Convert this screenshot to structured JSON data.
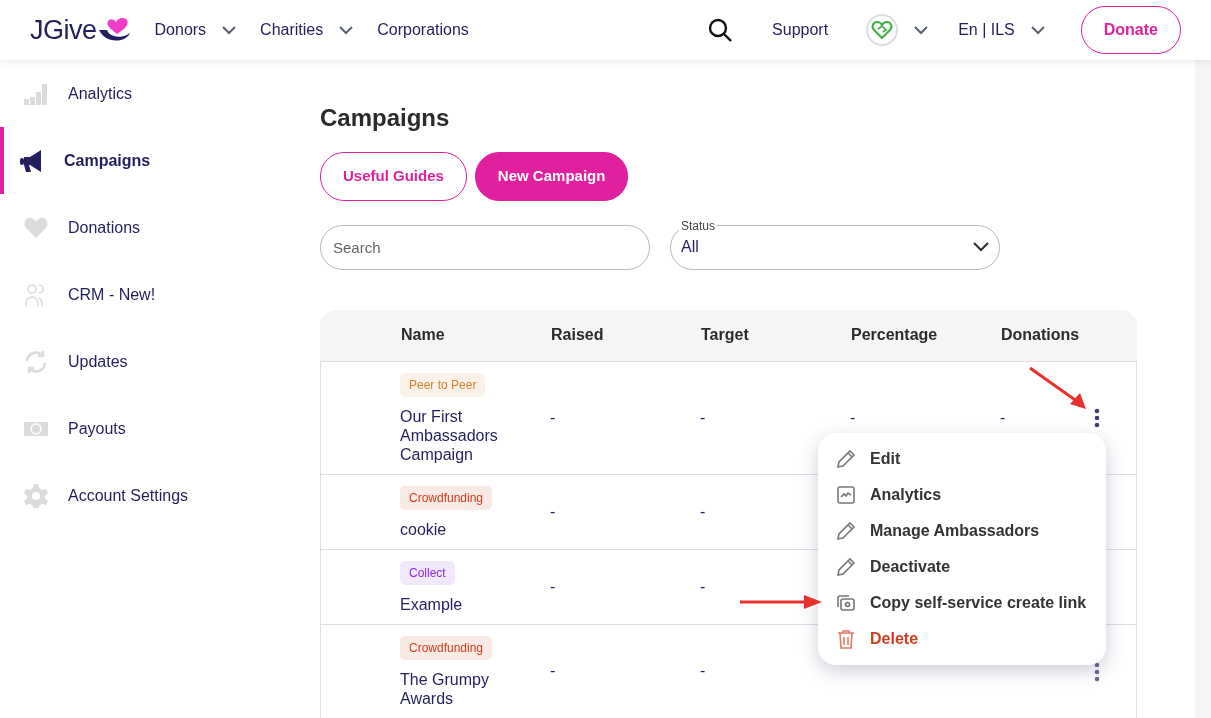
{
  "navbar": {
    "logo": "JGive",
    "items": [
      {
        "label": "Donors",
        "dropdown": true
      },
      {
        "label": "Charities",
        "dropdown": true
      },
      {
        "label": "Corporations",
        "dropdown": false
      }
    ],
    "support": "Support",
    "language": "En | ILS",
    "donate": "Donate"
  },
  "sidebar": {
    "items": [
      {
        "label": "Analytics",
        "selected": false
      },
      {
        "label": "Campaigns",
        "selected": true
      },
      {
        "label": "Donations",
        "selected": false
      },
      {
        "label": "CRM - New!",
        "selected": false
      },
      {
        "label": "Updates",
        "selected": false
      },
      {
        "label": "Payouts",
        "selected": false
      },
      {
        "label": "Account Settings",
        "selected": false
      }
    ]
  },
  "page_title": "Campaigns",
  "buttons": [
    {
      "label": "Useful Guides",
      "kind": "outline"
    },
    {
      "label": "New Campaign",
      "kind": "solid"
    }
  ],
  "search": {
    "placeholder": "Search"
  },
  "status": {
    "label": "Status",
    "value": "All"
  },
  "table": {
    "columns": [
      "Name",
      "Raised",
      "Target",
      "Percentage",
      "Donations"
    ],
    "rows": [
      {
        "tag": {
          "text": "Peer to Peer",
          "color": "#d4822e"
        },
        "name": "Our First Ambassadors Campaign",
        "raised": "-",
        "target": "-",
        "percentage": "-",
        "donations": "-",
        "menu_open": true
      },
      {
        "tag": {
          "text": "Crowdfunding",
          "color": "#d23c1e"
        },
        "name": "cookie",
        "raised": "-",
        "target": "-",
        "menu_open": false
      },
      {
        "tag": {
          "text": "Collect",
          "color": "#8a2be2"
        },
        "name": "Example",
        "raised": "-",
        "target": "-",
        "menu_open": false
      },
      {
        "tag": {
          "text": "Crowdfunding",
          "color": "#d23c1e"
        },
        "name": "The Grumpy Awards",
        "raised": "-",
        "target": "-",
        "menu_open": false
      }
    ]
  },
  "row_menu": {
    "items": [
      {
        "label": "Edit",
        "kind": "normal"
      },
      {
        "label": "Analytics",
        "kind": "normal"
      },
      {
        "label": "Manage Ambassadors",
        "kind": "normal"
      },
      {
        "label": "Deactivate",
        "kind": "normal"
      },
      {
        "label": "Copy self-service create link",
        "kind": "normal"
      },
      {
        "label": "Delete",
        "kind": "danger"
      }
    ]
  }
}
